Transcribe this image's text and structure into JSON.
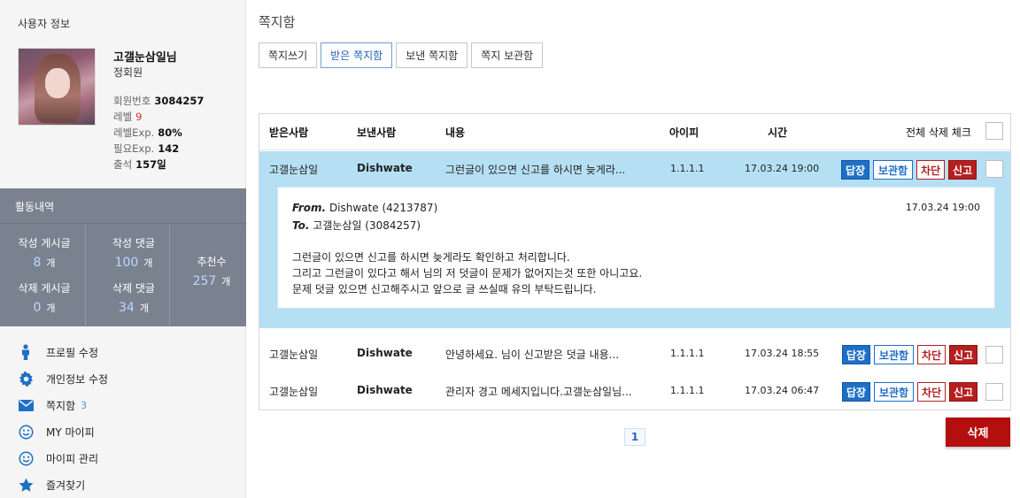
{
  "sidebar": {
    "title": "사용자 정보",
    "user": {
      "name": "고갤눈삼일님",
      "grade": "정회원",
      "stats": [
        {
          "label": "회원번호",
          "value": "3084257"
        },
        {
          "label": "레벨",
          "value": "9"
        },
        {
          "label": "레벨Exp.",
          "value": "80%"
        },
        {
          "label": "필요Exp.",
          "value": "142"
        },
        {
          "label": "출석",
          "value": "157일"
        }
      ]
    },
    "activity": {
      "title": "활동내역",
      "posts_label": "작성 게시글",
      "posts_value": "8",
      "comments_label": "작성 댓글",
      "comments_value": "100",
      "deleted_posts_label": "삭제 게시글",
      "deleted_posts_value": "0",
      "deleted_comments_label": "삭제 댓글",
      "deleted_comments_value": "34",
      "recommend_label": "추천수",
      "recommend_value": "257",
      "unit": "개"
    },
    "menu": [
      {
        "label": "프로필 수정",
        "icon": "person-icon"
      },
      {
        "label": "개인정보 수정",
        "icon": "gear-icon"
      },
      {
        "label": "쪽지함",
        "icon": "envelope-icon",
        "count": "3"
      },
      {
        "label": "MY 마이피",
        "icon": "smiley-icon"
      },
      {
        "label": "마이피 관리",
        "icon": "smiley-icon"
      },
      {
        "label": "즐겨찾기",
        "icon": "star-icon"
      }
    ]
  },
  "main": {
    "title": "쪽지함",
    "tabs": [
      "쪽지쓰기",
      "받은 쪽지함",
      "보낸 쪽지함",
      "쪽지 보관함"
    ],
    "active_tab": "받은 쪽지함",
    "columns": {
      "receiver": "받은사람",
      "sender": "보낸사람",
      "content": "내용",
      "ip": "아이피",
      "time": "시간",
      "select_all": "전체 삭제 체크"
    },
    "actions": {
      "reply": "답장",
      "keep": "보관함",
      "block": "차단",
      "report": "신고"
    },
    "messages": [
      {
        "receiver": "고갤눈삼일",
        "sender": "Dishwate",
        "content": "그런글이 있으면 신고를 하시면 늦게라...",
        "ip": "1.1.1.1",
        "time": "17.03.24 19:00"
      },
      {
        "receiver": "고갤눈삼일",
        "sender": "Dishwate",
        "content": "안녕하세요. 님이 신고받은 덧글 내용...",
        "ip": "1.1.1.1",
        "time": "17.03.24 18:55"
      },
      {
        "receiver": "고갤눈삼일",
        "sender": "Dishwate",
        "content": "관리자 경고 메세지입니다.고갤눈삼일님...",
        "ip": "1.1.1.1",
        "time": "17.03.24 06:47"
      }
    ],
    "detail": {
      "from_label": "From.",
      "from_value": "Dishwate (4213787)",
      "to_label": "To.",
      "to_value": "고갤눈삼일 (3084257)",
      "time": "17.03.24 19:00",
      "body": [
        "그런글이 있으면 신고를 하시면 늦게라도 확인하고 처리합니다.",
        "그리고 그런글이 있다고 해서 님의 저 덧글이 문제가 없어지는것 또한 아니고요.",
        "문제 덧글 있으면 신고해주시고 앞으로 글 쓰실때 유의 부탁드립니다."
      ]
    },
    "page": "1",
    "delete_label": "삭제"
  },
  "colors": {
    "activity_bg": "#7a8290",
    "open_row_bg": "#b5e0f4",
    "reply_blue": "#1e6fc6",
    "report_red": "#b51f1f",
    "delete_red": "#b30f0f"
  }
}
